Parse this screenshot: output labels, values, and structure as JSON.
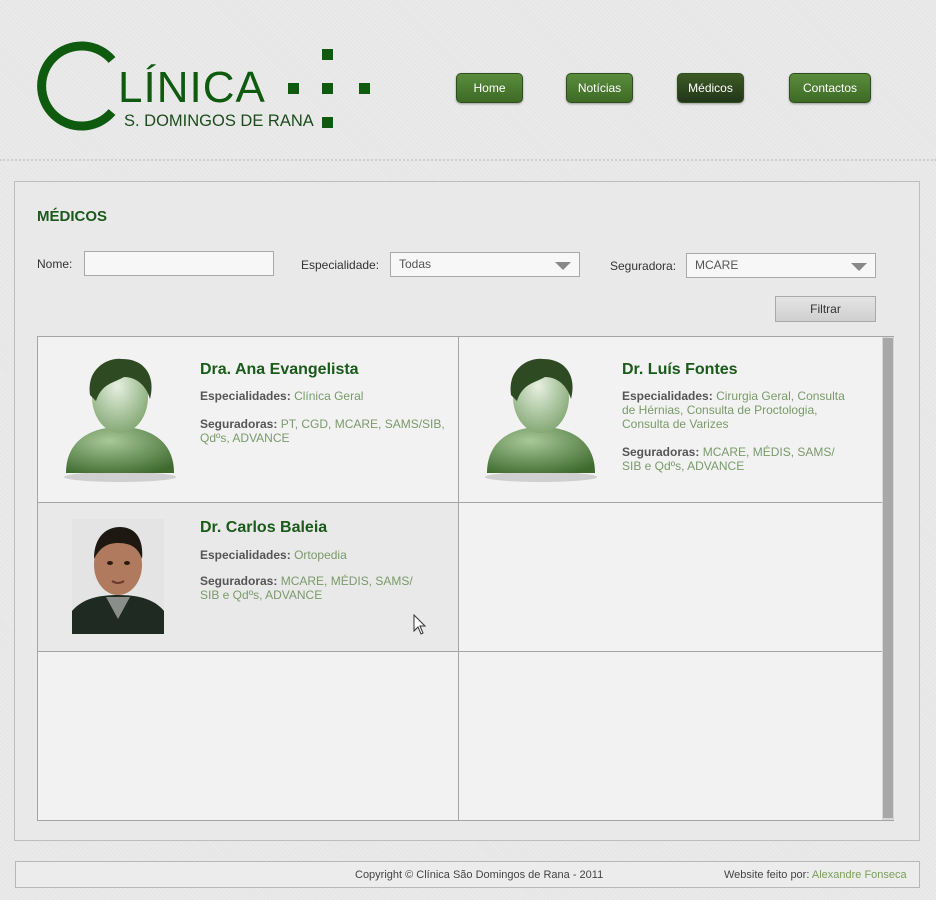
{
  "logo": {
    "title": "LÍNICA",
    "subtitle": "S. DOMINGOS DE RANA"
  },
  "nav": {
    "items": [
      {
        "label": "Home"
      },
      {
        "label": "Notícias"
      },
      {
        "label": "Médicos"
      },
      {
        "label": "Contactos"
      }
    ],
    "active": "Médicos"
  },
  "page": {
    "title": "MÉDICOS"
  },
  "filters": {
    "name_label": "Nome:",
    "name_value": "",
    "specialty_label": "Especialidade:",
    "specialty_value": "Todas",
    "insurer_label": "Seguradora:",
    "insurer_value": "MCARE",
    "filter_button": "Filtrar"
  },
  "doctors": [
    {
      "name": "Dra. Ana Evangelista",
      "specialties_label": "Especialidades:",
      "specialties": "Clínica Geral",
      "insurers_label": "Seguradoras:",
      "insurers": "PT, CGD, MCARE, SAMS/SIB, Qdºs, ADVANCE",
      "photo": "avatar-placeholder"
    },
    {
      "name": "Dr. Luís Fontes",
      "specialties_label": "Especialidades:",
      "specialties": "Cirurgia Geral, Consulta de Hérnias, Consulta de Proctologia, Consulta de Varizes",
      "insurers_label": "Seguradoras:",
      "insurers": "MCARE, MÉDIS, SAMS/ SIB e Qdºs, ADVANCE",
      "photo": "avatar-placeholder"
    },
    {
      "name": "Dr. Carlos Baleia",
      "specialties_label": "Especialidades:",
      "specialties": "Ortopedia",
      "insurers_label": "Seguradoras:",
      "insurers": "MCARE, MÉDIS, SAMS/ SIB e Qdºs, ADVANCE",
      "photo": "portrait-photo"
    }
  ],
  "footer": {
    "copyright": "Copyright © Clínica São Domingos de Rana - 2011",
    "made_by_label": "Website feito por:",
    "made_by_name": "Alexandre Fonseca"
  },
  "colors": {
    "brand_green": "#0e5a0e",
    "nav_green": "#4e7c32",
    "link_green": "#7a9a6a"
  }
}
